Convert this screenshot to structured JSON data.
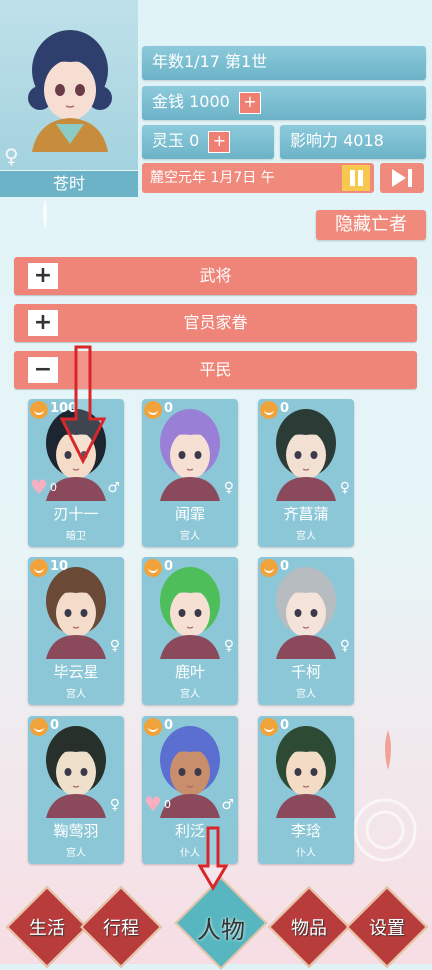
{
  "player": {
    "name": "苍时",
    "gender_symbol": "♀"
  },
  "stats": {
    "year_label": "年数1/17  第1世",
    "money_label": "金钱 1000",
    "jade_label": "灵玉 0",
    "influence_label": "影响力 4018",
    "plus_symbol": "+"
  },
  "date": "麓空元年 1月7日 午",
  "hide_dead_label": "隐藏亡者",
  "categories": [
    {
      "toggle": "+",
      "label": "武将"
    },
    {
      "toggle": "+",
      "label": "官员家眷"
    },
    {
      "toggle": "−",
      "label": "平民"
    }
  ],
  "characters": [
    {
      "name": "刃十一",
      "role": "暗卫",
      "mood": "100",
      "affection": "0",
      "gender": "♂",
      "hair": "#1d2530",
      "skin": "#f4dcc9"
    },
    {
      "name": "闻霏",
      "role": "宫人",
      "mood": "0",
      "affection": "",
      "gender": "♀",
      "hair": "#9a7fd6",
      "skin": "#f6e0d3"
    },
    {
      "name": "齐菖蒲",
      "role": "宫人",
      "mood": "0",
      "affection": "",
      "gender": "♀",
      "hair": "#2b3b36",
      "skin": "#f2e0d2"
    },
    {
      "name": "毕云星",
      "role": "宫人",
      "mood": "10",
      "affection": "",
      "gender": "♀",
      "hair": "#6a4a36",
      "skin": "#f4dccb"
    },
    {
      "name": "鹿叶",
      "role": "宫人",
      "mood": "0",
      "affection": "",
      "gender": "♀",
      "hair": "#4dbe5a",
      "skin": "#f6e0d3"
    },
    {
      "name": "千柯",
      "role": "宫人",
      "mood": "0",
      "affection": "",
      "gender": "♀",
      "hair": "#b7bcc0",
      "skin": "#f3e3d9"
    },
    {
      "name": "鞠莺羽",
      "role": "宫人",
      "mood": "0",
      "affection": "",
      "gender": "♀",
      "hair": "#27302a",
      "skin": "#efe0cc"
    },
    {
      "name": "利泛",
      "role": "仆人",
      "mood": "0",
      "affection": "0",
      "gender": "♂",
      "hair": "#5a6fd0",
      "skin": "#c98e6c"
    },
    {
      "name": "李琀",
      "role": "仆人",
      "mood": "0",
      "affection": "",
      "gender": "",
      "hair": "#2c4a34",
      "skin": "#f3dcc6"
    }
  ],
  "nav": [
    {
      "label": "生活",
      "active": false
    },
    {
      "label": "行程",
      "active": false
    },
    {
      "label": "人物",
      "active": true
    },
    {
      "label": "物品",
      "active": false
    },
    {
      "label": "设置",
      "active": false
    }
  ],
  "colors": {
    "accent_red": "#ef8478",
    "teal": "#6cb3c8",
    "gold": "#f6c94e"
  }
}
